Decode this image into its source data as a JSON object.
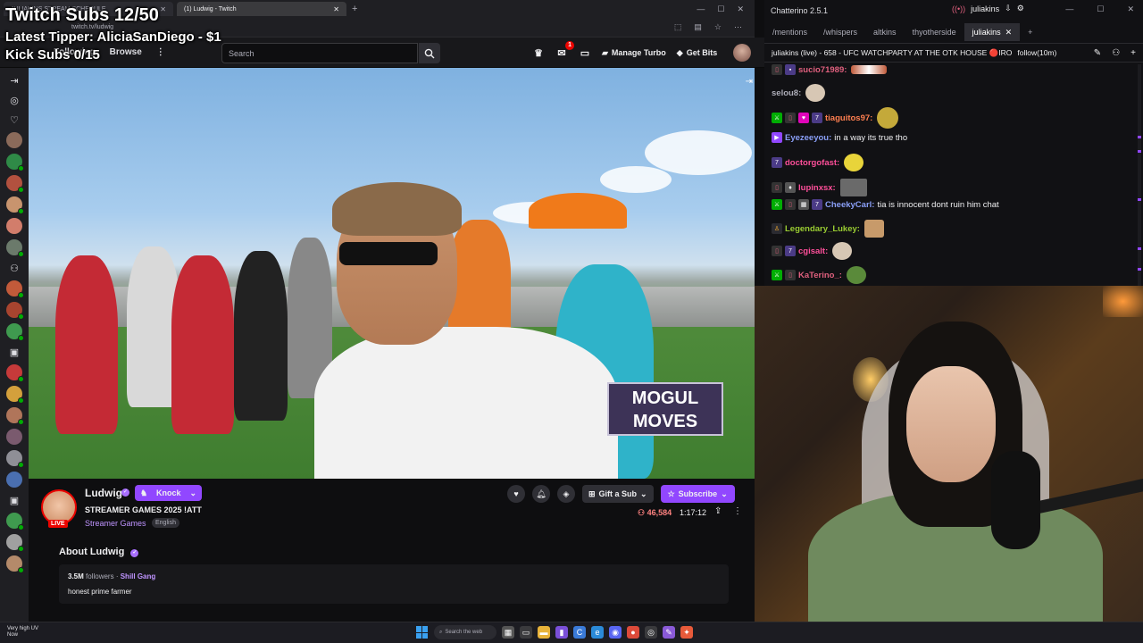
{
  "browser": {
    "tabs": [
      {
        "label": "JULIAKINS STREAM SCHEDULE"
      },
      {
        "label": "(1) Ludwig - Twitch"
      }
    ],
    "url": "twitch.tv/ludwig"
  },
  "overlay": {
    "line1": "Twitch Subs 12/50",
    "line2": "Latest Tipper: AliciaSanDiego - $1",
    "line3": "Kick Subs 0/15"
  },
  "twitch_nav": {
    "following": "Following",
    "browse": "Browse",
    "search_placeholder": "Search",
    "notif_count": "1",
    "manage_turbo": "Manage Turbo",
    "get_bits": "Get Bits"
  },
  "video": {
    "mogul_line1": "MOGUL",
    "mogul_line2": "MOVES"
  },
  "channel": {
    "name": "Ludwig",
    "knock_label": "Knock",
    "stream_title": "STREAMER GAMES 2025 !ATT",
    "category": "Streamer Games",
    "language": "English",
    "live_label": "LIVE",
    "gift_label": "Gift a Sub",
    "subscribe_label": "Subscribe",
    "viewers": "46,584",
    "uptime": "1:17:12",
    "about_title": "About Ludwig",
    "followers_count": "3.5M",
    "followers_label": "followers",
    "team": "Shill Gang",
    "bio": "honest prime farmer"
  },
  "chatterino": {
    "app_title": "Chatterino 2.5.1",
    "account": "juliakins",
    "tabs": [
      "/mentions",
      "/whispers",
      "altkins",
      "thyotherside",
      "juliakins"
    ],
    "active_tab": "juliakins",
    "channel_header": "juliakins (live) - 658 - UFC WATCHPARTY AT THE OTK HOUSE 🔴IRO",
    "follow_mode": "follow(10m)",
    "messages": [
      {
        "user": "sucio71989:",
        "text": "",
        "color": "#e0607e"
      },
      {
        "user": "selou8:",
        "text": "",
        "color": "#adadb8"
      },
      {
        "user": "tiaguitos97:",
        "text": "",
        "color": "#ff7f50"
      },
      {
        "user": "Eyezeeyou:",
        "text": "in a way its true tho",
        "color": "#8a9ff7"
      },
      {
        "user": "doctorgofast:",
        "text": "",
        "color": "#ff4f9a"
      },
      {
        "user": "lupinxsx:",
        "text": "",
        "color": "#ff4f9a"
      },
      {
        "user": "CheekyCarl:",
        "text": "tia is innocent dont ruin him chat",
        "color": "#8a9ff7"
      },
      {
        "user": "Legendary_Lukey:",
        "text": "",
        "color": "#9acd32"
      },
      {
        "user": "cgisalt:",
        "text": "",
        "color": "#ff4f9a"
      },
      {
        "user": "KaTerino_:",
        "text": "",
        "color": "#e0607e"
      }
    ]
  },
  "taskbar": {
    "weather_line1": "Very high UV",
    "weather_line2": "Now",
    "search_label": "Search the web"
  },
  "colors": {
    "twitch_purple": "#9147ff",
    "live_red": "#eb0400"
  }
}
